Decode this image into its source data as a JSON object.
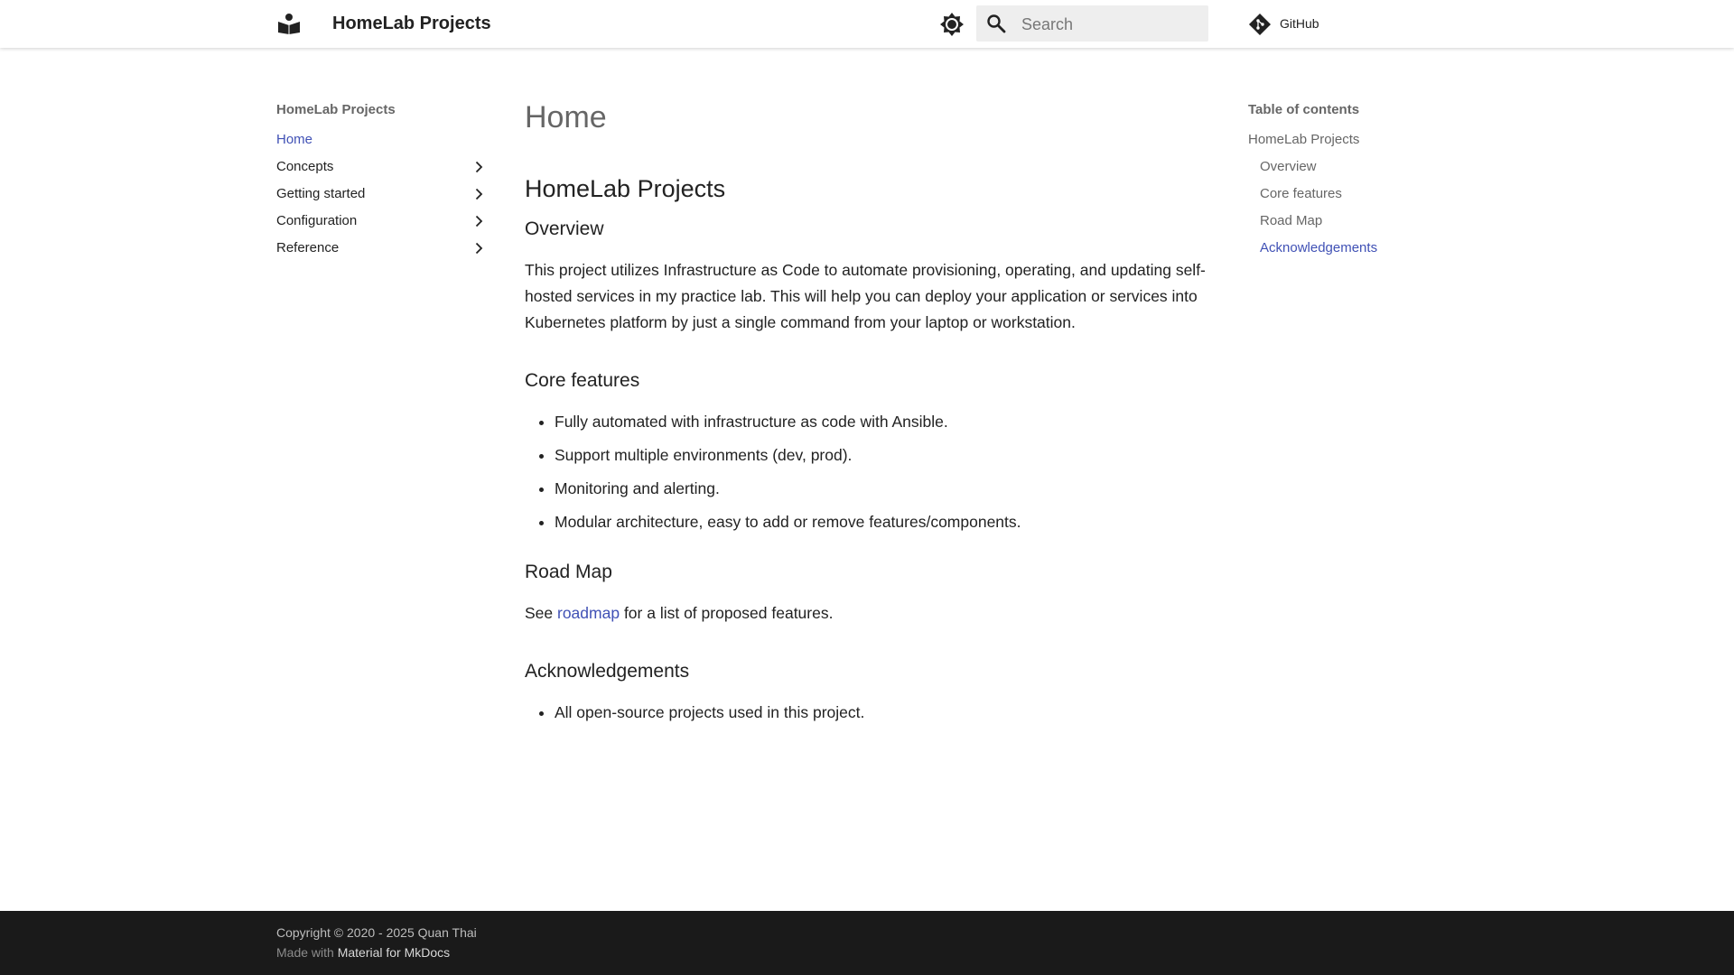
{
  "header": {
    "site_title": "HomeLab Projects",
    "logo_icon": "book-open-icon",
    "theme_toggle_icon": "brightness-icon",
    "search": {
      "placeholder": "Search",
      "value": "",
      "icon": "search-icon"
    },
    "repo": {
      "label": "GitHub",
      "icon": "git-icon"
    }
  },
  "nav": {
    "title": "HomeLab Projects",
    "items": [
      {
        "label": "Home",
        "active": true,
        "expandable": false
      },
      {
        "label": "Concepts",
        "active": false,
        "expandable": true
      },
      {
        "label": "Getting started",
        "active": false,
        "expandable": true
      },
      {
        "label": "Configuration",
        "active": false,
        "expandable": true
      },
      {
        "label": "Reference",
        "active": false,
        "expandable": true
      }
    ]
  },
  "content": {
    "page_title": "Home",
    "h1": "HomeLab Projects",
    "overview": {
      "heading": "Overview",
      "text": "This project utilizes Infrastructure as Code to automate provisioning, operating, and updating self-hosted services in my practice lab. This will help you can deploy your application or services into Kubernetes platform by just a single command from your laptop or workstation."
    },
    "core_features": {
      "heading": "Core features",
      "items": [
        "Fully automated with infrastructure as code with Ansible.",
        "Support multiple environments (dev, prod).",
        "Monitoring and alerting.",
        "Modular architecture, easy to add or remove features/components."
      ]
    },
    "road_map": {
      "heading": "Road Map",
      "before": "See ",
      "link": "roadmap",
      "after": " for a list of proposed features."
    },
    "acknowledgements": {
      "heading": "Acknowledgements",
      "items": [
        "All open-source projects used in this project."
      ]
    }
  },
  "toc": {
    "title": "Table of contents",
    "items": [
      {
        "label": "HomeLab Projects",
        "level": 1,
        "active": false
      },
      {
        "label": "Overview",
        "level": 2,
        "active": false
      },
      {
        "label": "Core features",
        "level": 2,
        "active": false
      },
      {
        "label": "Road Map",
        "level": 2,
        "active": false
      },
      {
        "label": "Acknowledgements",
        "level": 2,
        "active": true
      }
    ]
  },
  "footer": {
    "copyright": "Copyright © 2020 - 2025 Quan Thai",
    "made_with_prefix": "Made with ",
    "made_with_link": "Material for MkDocs"
  },
  "colors": {
    "accent": "#4051b5",
    "footer_bg": "#1a1a1a",
    "search_bg": "#eeeeee"
  }
}
